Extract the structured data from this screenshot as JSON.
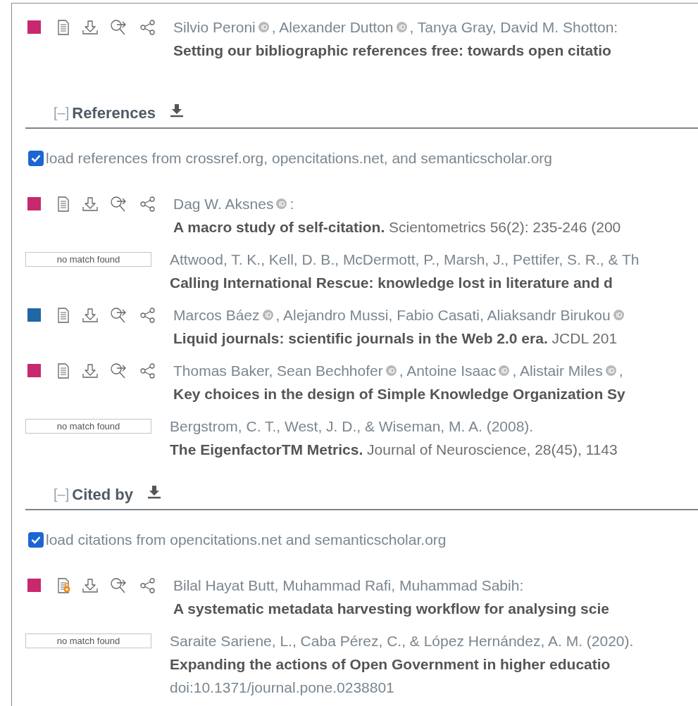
{
  "top_entry": {
    "kind": "dblp",
    "color": "#c8286e",
    "open_access": false,
    "authors": [
      {
        "kind": "name",
        "text": "Silvio Peroni"
      },
      {
        "kind": "orcid"
      },
      {
        "kind": "name",
        "text": ", Alexander Dutton"
      },
      {
        "kind": "orcid"
      },
      {
        "kind": "name",
        "text": ", Tanya Gray, David M. Shotton:"
      }
    ],
    "citation": "**Setting our bibliographic references free: towards open citatio**"
  },
  "sections": [
    {
      "toggle": "[–]",
      "title": "References",
      "load_option": {
        "label": "load references from crossref.org, opencitations.net, and semanticscholar.org",
        "checked": true
      },
      "entries": [
        {
          "kind": "dblp",
          "color": "#c8286e",
          "open_access": false,
          "authors": [
            {
              "kind": "name",
              "text": "Dag W. Aksnes"
            },
            {
              "kind": "orcid"
            },
            {
              "kind": "name",
              "text": ":"
            }
          ],
          "citation": "**A macro study of self-citation.** Scientometrics 56(2): 235-246 (200"
        },
        {
          "kind": "nomatch",
          "badge": "no match found",
          "authors": [
            {
              "kind": "name",
              "text": "Attwood, T. K., Kell, D. B., McDermott, P., Marsh, J., Pettifer, S. R., & Th"
            }
          ],
          "citation": "**Calling International Rescue: knowledge lost in literature and d**"
        },
        {
          "kind": "dblp",
          "color": "#1f67a5",
          "open_access": false,
          "authors": [
            {
              "kind": "name",
              "text": "Marcos Báez"
            },
            {
              "kind": "orcid"
            },
            {
              "kind": "name",
              "text": ", Alejandro Mussi, Fabio Casati, Aliaksandr Birukou"
            },
            {
              "kind": "orcid"
            }
          ],
          "citation": "**Liquid journals: scientific journals in the Web 2.0 era.** JCDL 201"
        },
        {
          "kind": "dblp",
          "color": "#c8286e",
          "open_access": false,
          "authors": [
            {
              "kind": "name",
              "text": "Thomas Baker, Sean Bechhofer"
            },
            {
              "kind": "orcid"
            },
            {
              "kind": "name",
              "text": ", Antoine Isaac"
            },
            {
              "kind": "orcid"
            },
            {
              "kind": "name",
              "text": ", Alistair Miles"
            },
            {
              "kind": "orcid"
            },
            {
              "kind": "name",
              "text": ","
            }
          ],
          "citation": "**Key choices in the design of Simple Knowledge Organization Sy**"
        },
        {
          "kind": "nomatch",
          "badge": "no match found",
          "authors": [
            {
              "kind": "name",
              "text": "Bergstrom, C. T., West, J. D., & Wiseman, M. A. (2008)."
            }
          ],
          "citation": "**The EigenfactorTM Metrics.** Journal of Neuroscience, 28(45), 1143"
        }
      ]
    },
    {
      "toggle": "[–]",
      "title": "Cited by",
      "load_option": {
        "label": "load citations from opencitations.net and semanticscholar.org",
        "checked": true
      },
      "entries": [
        {
          "kind": "dblp",
          "color": "#c8286e",
          "open_access": true,
          "authors": [
            {
              "kind": "name",
              "text": "Bilal Hayat Butt, Muhammad Rafi, Muhammad Sabih:"
            }
          ],
          "citation": "**A systematic metadata harvesting workflow for analysing scie**"
        },
        {
          "kind": "nomatch",
          "badge": "no match found",
          "authors": [
            {
              "kind": "name",
              "text": "Saraite Sariene, L., Caba Pérez, C., & López Hernández, A. M. (2020)."
            }
          ],
          "citation": "**Expanding the actions of Open Government in higher educatio**",
          "extra": "doi:10.1371/journal.pone.0238801"
        }
      ]
    }
  ]
}
